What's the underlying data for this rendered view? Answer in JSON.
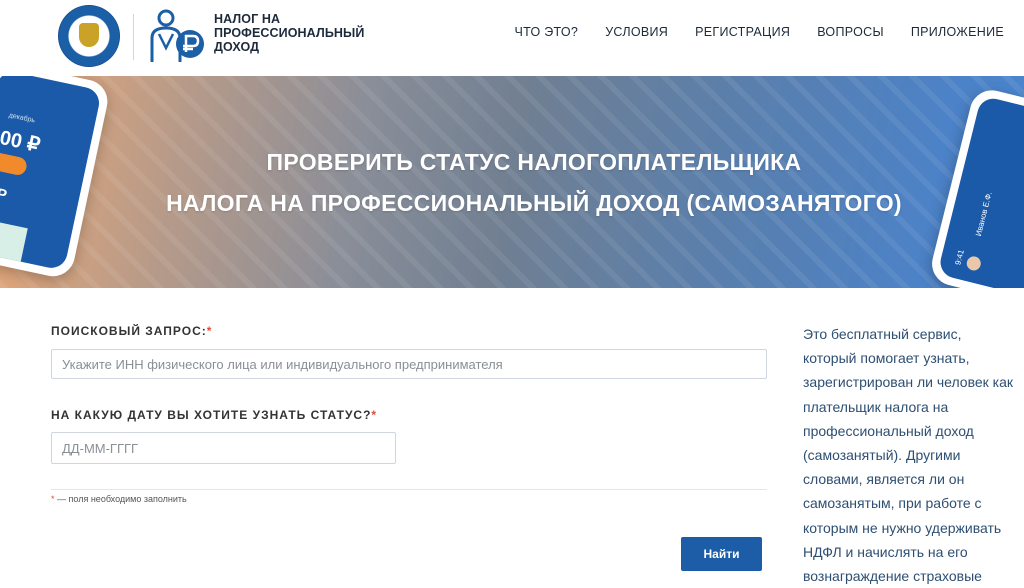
{
  "header": {
    "brand_line1": "НАЛОГ НА",
    "brand_line2": "ПРОФЕССИОНАЛЬНЫЙ",
    "brand_line3": "ДОХОД",
    "emblem_text": "ФЕДЕРАЛЬНАЯ НАЛОГОВАЯ СЛУЖБА",
    "nav": [
      "ЧТО ЭТО?",
      "УСЛОВИЯ",
      "РЕГИСТРАЦИЯ",
      "ВОПРОСЫ",
      "ПРИЛОЖЕНИЕ"
    ]
  },
  "banner": {
    "title_line1": "ПРОВЕРИТЬ СТАТУС НАЛОГОПЛАТЕЛЬЩИКА",
    "title_line2": "НАЛОГА НА ПРОФЕССИОНАЛЬНЫЙ ДОХОД (САМОЗАНЯТОГО)",
    "phone_left_month": "декабрь",
    "phone_left_amount1": "00 ₽",
    "phone_left_amount2": "0 Р",
    "phone_right_name": "Иванов Е.Ф.",
    "phone_right_time": "9:41"
  },
  "form": {
    "search_label": "ПОИСКОВЫЙ ЗАПРОС:",
    "search_placeholder": "Укажите ИНН физического лица или индивидуального предпринимателя",
    "date_label": "НА КАКУЮ ДАТУ ВЫ ХОТИТЕ УЗНАТЬ СТАТУС?",
    "date_placeholder": "ДД-ММ-ГГГГ",
    "required_mark": "*",
    "required_note": "— поля необходимо заполнить",
    "submit_label": "Найти"
  },
  "aside": {
    "text": "Это бесплатный сервис, который помогает узнать, зарегистрирован ли человек как плательщик налога на профессиональный доход (самозанятый). Другими словами, является ли он самозанятым, при работе с которым не нужно удерживать НДФЛ и начислять на его вознаграждение страховые"
  },
  "colors": {
    "primary": "#1d5da8",
    "required": "#e04a3a",
    "aside_text": "#2e4f72"
  }
}
